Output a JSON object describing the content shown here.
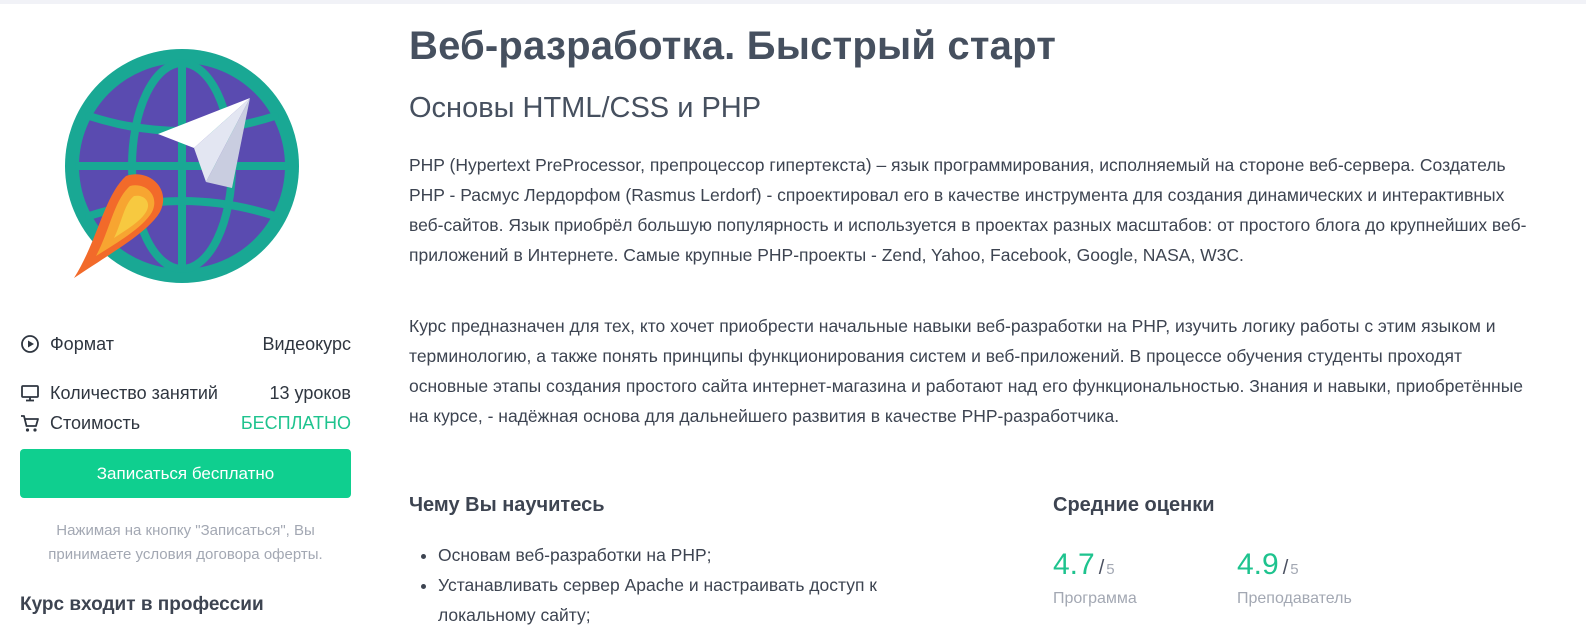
{
  "course": {
    "title": "Веб-разработка. Быстрый старт",
    "subtitle": "Основы HTML/CSS и PHP",
    "description": [
      "PHP (Hypertext PreProcessor, препроцессор гипертекста) – язык программирования, исполняемый на стороне веб-сервера. Создатель PHP - Расмус Лердорфом (Rasmus Lerdorf) - спроектировал его в качестве инструмента для создания динамических и интерактивных веб-сайтов. Язык приобрёл большую популярность и используется в проектах разных масштабов: от простого блога до крупнейших веб-приложений в Интернете. Самые крупные PHP-проекты - Zend, Yahoo, Facebook, Google, NASA, W3C.",
      "Курс предназначен для тех, кто хочет приобрести начальные навыки веб-разработки на PHP, изучить логику работы с этим языком и терминологию, а также понять принципы функционирования систем и веб-приложений. В процессе обучения студенты проходят основные этапы создания простого сайта интернет-магазина и работают над его функциональностью. Знания и навыки, приобретённые на курсе, - надёжная основа для дальнейшего развития в качестве PHP-разработчика."
    ]
  },
  "sidebar": {
    "logo_icon": "globe-rocket-icon",
    "meta": [
      {
        "icon": "play-circle-icon",
        "label": "Формат",
        "value": "Видеокурс"
      },
      {
        "icon": "monitor-icon",
        "label": "Количество занятий",
        "value": "13 уроков"
      },
      {
        "icon": "cart-icon",
        "label": "Стоимость",
        "value": "БЕСПЛАТНО"
      }
    ],
    "enroll_label": "Записаться бесплатно",
    "offer_note": "Нажимая на кнопку \"Записаться\", Вы принимаете условия договора оферты.",
    "professions_title": "Курс входит в профессии"
  },
  "learn": {
    "title": "Чему Вы научитесь",
    "items": [
      "Основам веб-разработки на PHP;",
      "Устанавливать сервер Apache и настраивать доступ к локальному сайту;"
    ]
  },
  "ratings": {
    "title": "Средние оценки",
    "separator": "/",
    "items": [
      {
        "score": "4.7",
        "max": "5",
        "label": "Программа"
      },
      {
        "score": "4.9",
        "max": "5",
        "label": "Преподаватель"
      }
    ]
  },
  "colors": {
    "accent_green": "#0fcf8f",
    "free_green": "#1ec38e",
    "globe_ring": "#19a894",
    "globe_fill": "#5a4bb0",
    "rocket_flame_orange": "#f26a2a",
    "rocket_flame_yellow": "#f7c940"
  }
}
